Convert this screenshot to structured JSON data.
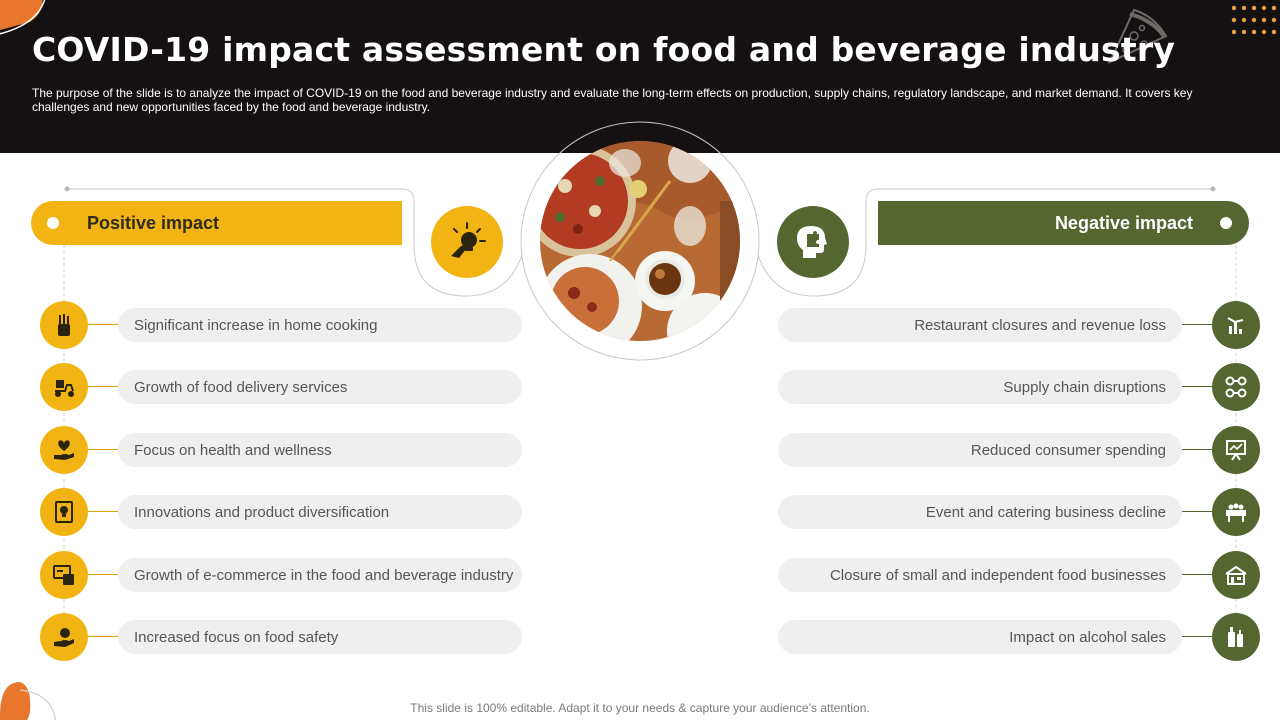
{
  "header": {
    "title": "COVID-19 impact assessment on food and beverage industry",
    "subtitle": "The purpose of the slide is to analyze the impact of COVID-19 on the food and beverage industry and evaluate the long-term effects on production, supply chains, regulatory landscape, and market demand. It covers key challenges and new opportunities faced by the food and beverage industry."
  },
  "positive": {
    "label": "Positive impact",
    "icon": "lightbulb-hand-icon",
    "items": [
      {
        "text": "Significant increase in home cooking",
        "icon": "kitchen-utensils-icon"
      },
      {
        "text": "Growth of food delivery services",
        "icon": "delivery-scooter-icon"
      },
      {
        "text": "Focus on health and wellness",
        "icon": "heart-hand-icon"
      },
      {
        "text": "Innovations and product diversification",
        "icon": "idea-board-icon"
      },
      {
        "text": "Growth of e-commerce in the food and beverage industry",
        "icon": "ecommerce-icon"
      },
      {
        "text": "Increased focus on food safety",
        "icon": "food-safety-icon"
      }
    ]
  },
  "negative": {
    "label": "Negative impact",
    "icon": "puzzle-head-icon",
    "items": [
      {
        "text": "Restaurant closures and revenue loss",
        "icon": "revenue-loss-icon"
      },
      {
        "text": "Supply chain disruptions",
        "icon": "supply-chain-icon"
      },
      {
        "text": "Reduced consumer spending",
        "icon": "spending-chart-icon"
      },
      {
        "text": "Event and catering business decline",
        "icon": "catering-table-icon"
      },
      {
        "text": "Closure of small and independent food businesses",
        "icon": "small-business-icon"
      },
      {
        "text": "Impact on alcohol sales",
        "icon": "alcohol-bottles-icon"
      }
    ]
  },
  "colors": {
    "header_bg": "#151112",
    "positive": "#f2b413",
    "negative": "#566631",
    "pill": "#efefef",
    "accent_orange": "#e8762c"
  },
  "footer": {
    "text": "This slide is 100% editable. Adapt it to your needs & capture your audience’s attention."
  }
}
